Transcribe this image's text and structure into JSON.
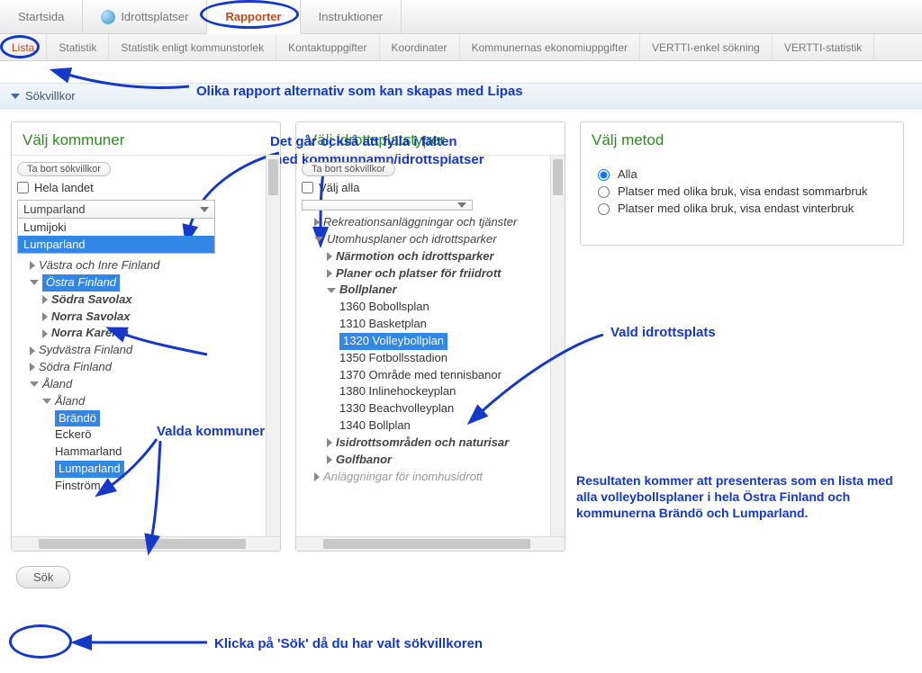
{
  "tabs_main": {
    "startsida": "Startsida",
    "idrottsplatser": "Idrottsplatser",
    "rapporter": "Rapporter",
    "instruktioner": "Instruktioner"
  },
  "tabs_sub": {
    "lista": "Lista",
    "statistik": "Statistik",
    "statistik_kommun": "Statistik enligt kommunstorlek",
    "kontakt": "Kontaktuppgifter",
    "koord": "Koordinater",
    "ekonomi": "Kommunernas ekonomiuppgifter",
    "vertti_sok": "VERTTI-enkel sökning",
    "vertti_stat": "VERTTI-statistik"
  },
  "captions": {
    "c1": "Olika rapport alternativ som kan skapas med Lipas",
    "c2a": "Det går också att fylla i fälten",
    "c2b": "med kommunnamn/idrottsplatser",
    "c3": "Valda kommuner",
    "c4": "Vald idrottsplats",
    "c5": "Resultaten kommer att presenteras som en lista med alla volleybollsplaner i hela Östra Finland och kommunerna Brändö och Lumparland.",
    "c6": "Klicka på 'Sök' då du har valt sökvillkoren"
  },
  "filterbar": {
    "label": "Sökvillkor"
  },
  "panel1": {
    "title": "Välj kommuner",
    "remove": "Ta bort sökvillkor",
    "hela": "Hela landet",
    "combo": "Lumparland",
    "dd_opt1": "Lumijoki",
    "dd_opt2": "Lumparland",
    "tree": {
      "vastra": "Västra och Inre Finland",
      "ostra": "Östra Finland",
      "sodra_sav": "Södra Savolax",
      "norra_sav": "Norra Savolax",
      "norra_kar": "Norra Karelen",
      "sydvastra": "Sydvästra Finland",
      "sodra_fin": "Södra Finland",
      "aland1": "Åland",
      "aland2": "Åland",
      "brando": "Brändö",
      "eckero": "Eckerö",
      "hammarland": "Hammarland",
      "lumparland": "Lumparland",
      "finstrom": "Finström"
    }
  },
  "panel2": {
    "title": "Välj idrottsplatstyper",
    "remove": "Ta bort sökvillkor",
    "alla": "Välj alla",
    "tree": {
      "rekre": "Rekreationsanläggningar och tjänster",
      "utom": "Utomhusplaner och idrottsparker",
      "narm": "Närmotion och idrottsparker",
      "planer": "Planer och platser för friidrott",
      "boll": "Bollplaner",
      "n1360": "1360 Bobollsplan",
      "n1310": "1310 Basketplan",
      "n1320": "1320 Volleybollplan",
      "n1350": "1350 Fotbollsstadion",
      "n1370": "1370 Område med tennisbanor",
      "n1380": "1380 Inlinehockeyplan",
      "n1330": "1330 Beachvolleyplan",
      "n1340": "1340 Bollplan",
      "isid": "Isidrottsområden och naturisar",
      "golf": "Golfbanor",
      "inom": "Anläggningar för inomhusidrott"
    }
  },
  "panel3": {
    "title": "Välj metod",
    "r1": "Alla",
    "r2": "Platser med olika bruk, visa endast sommarbruk",
    "r3": "Platser med olika bruk, visa endast vinterbruk"
  },
  "sok": "Sök"
}
